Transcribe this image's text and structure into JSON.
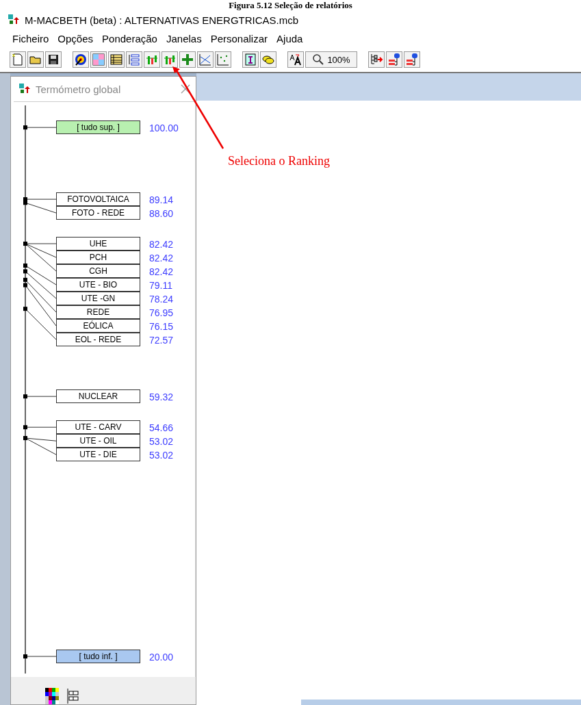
{
  "figure_caption": "Figura 5.12 Seleção de relatórios",
  "window": {
    "title": "M-MACBETH (beta) : ALTERNATIVAS ENERGTRICAS.mcb"
  },
  "menu": [
    "Ficheiro",
    "Opções",
    "Ponderação",
    "Janelas",
    "Personalizar",
    "Ajuda"
  ],
  "toolbar": {
    "zoom": "100%"
  },
  "child_window": {
    "title": "Termómetro global",
    "items": [
      {
        "label": "[ tudo sup. ]",
        "value": "100.00",
        "kind": "top"
      },
      {
        "label": "FOTOVOLTAICA",
        "value": "89.14",
        "kind": "option"
      },
      {
        "label": "FOTO - REDE",
        "value": "88.60",
        "kind": "option"
      },
      {
        "label": "UHE",
        "value": "82.42",
        "kind": "option"
      },
      {
        "label": "PCH",
        "value": "82.42",
        "kind": "option"
      },
      {
        "label": "CGH",
        "value": "82.42",
        "kind": "option"
      },
      {
        "label": "UTE - BIO",
        "value": "79.11",
        "kind": "option"
      },
      {
        "label": "UTE -GN",
        "value": "78.24",
        "kind": "option"
      },
      {
        "label": "REDE",
        "value": "76.95",
        "kind": "option"
      },
      {
        "label": "EÓLICA",
        "value": "76.15",
        "kind": "option"
      },
      {
        "label": "EOL - REDE",
        "value": "72.57",
        "kind": "option"
      },
      {
        "label": "NUCLEAR",
        "value": "59.32",
        "kind": "option"
      },
      {
        "label": "UTE - CARV",
        "value": "54.66",
        "kind": "option"
      },
      {
        "label": "UTE - OIL",
        "value": "53.02",
        "kind": "option"
      },
      {
        "label": "UTE - DIE",
        "value": "53.02",
        "kind": "option"
      },
      {
        "label": "[ tudo inf. ]",
        "value": "20.00",
        "kind": "bottom"
      }
    ]
  },
  "annotation": {
    "text": "Seleciona o Ranking"
  }
}
